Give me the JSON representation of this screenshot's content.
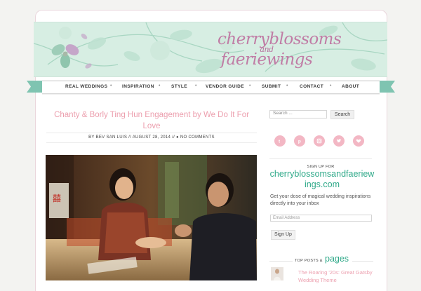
{
  "header": {
    "logo_line1": "cherryblossoms",
    "logo_and": "and",
    "logo_line2": "faeriewings"
  },
  "nav": {
    "items": [
      "REAL WEDDINGS",
      "INSPIRATION",
      "STYLE",
      "VENDOR GUIDE",
      "SUBMIT",
      "CONTACT",
      "ABOUT"
    ]
  },
  "post": {
    "title": "Chanty & Borly Ting Hun Engagement by We Do It For Love",
    "meta": "BY BEV SAN LUIS // AUGUST 28, 2014 // ● NO COMMENTS",
    "photo_text": "囍"
  },
  "sidebar": {
    "search_placeholder": "Search ...",
    "search_button": "Search",
    "social_icons": [
      "twitter-icon",
      "pinterest-icon",
      "instagram-icon",
      "twitter-bird-icon",
      "heart-icon"
    ],
    "signup_label": "SIGN UP FOR",
    "signup_site": "cherryblossomsandfaeriewings.com",
    "signup_desc": "Get your dose of magical wedding inspirations directly into your inbox",
    "email_placeholder": "Email Address",
    "signup_button": "Sign Up",
    "top_posts_label": "TOP POSTS &",
    "top_posts_pages": "pages",
    "top_post_title": "The Roaring '20s: Great Gatsby Wedding Theme"
  },
  "colors": {
    "accent_pink": "#ec9fae",
    "accent_teal": "#2fa989",
    "ribbon": "#7fc4b1",
    "banner": "#d7eee3",
    "social_pink": "#f3b7c4"
  }
}
